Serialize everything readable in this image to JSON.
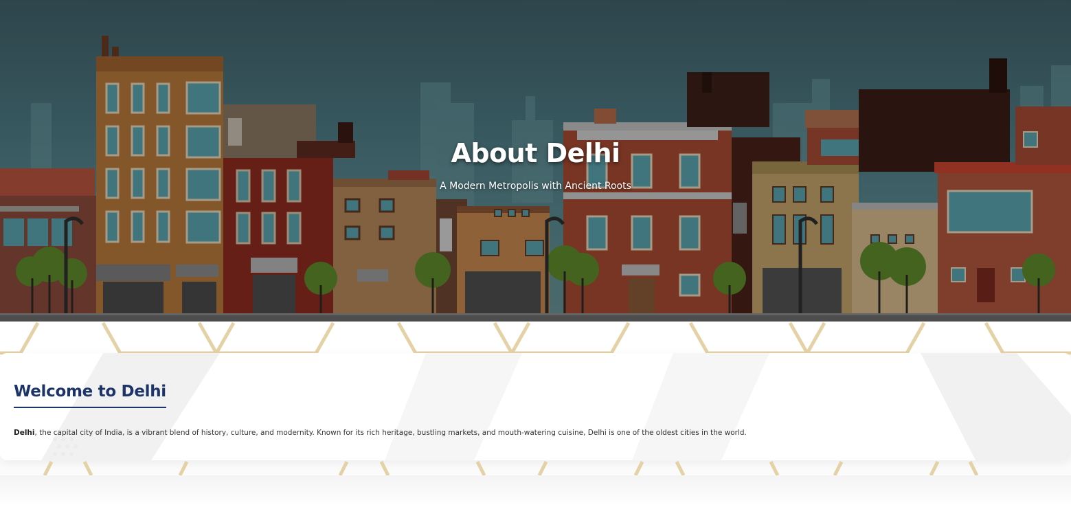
{
  "hero": {
    "title": "About Delhi",
    "subtitle": "A Modern Metropolis with Ancient Roots"
  },
  "intro": {
    "heading": "Welcome to Delhi",
    "lead": "Delhi",
    "body": ", the capital city of India, is a vibrant blend of history, culture, and modernity. Known for its rich heritage, bustling markets, and mouth-watering cuisine, Delhi is one of the oldest cities in the world."
  },
  "colors": {
    "heading": "#1d3468",
    "pattern_gold": "#e4d2a6",
    "hero_sky": "#4f7d86"
  }
}
